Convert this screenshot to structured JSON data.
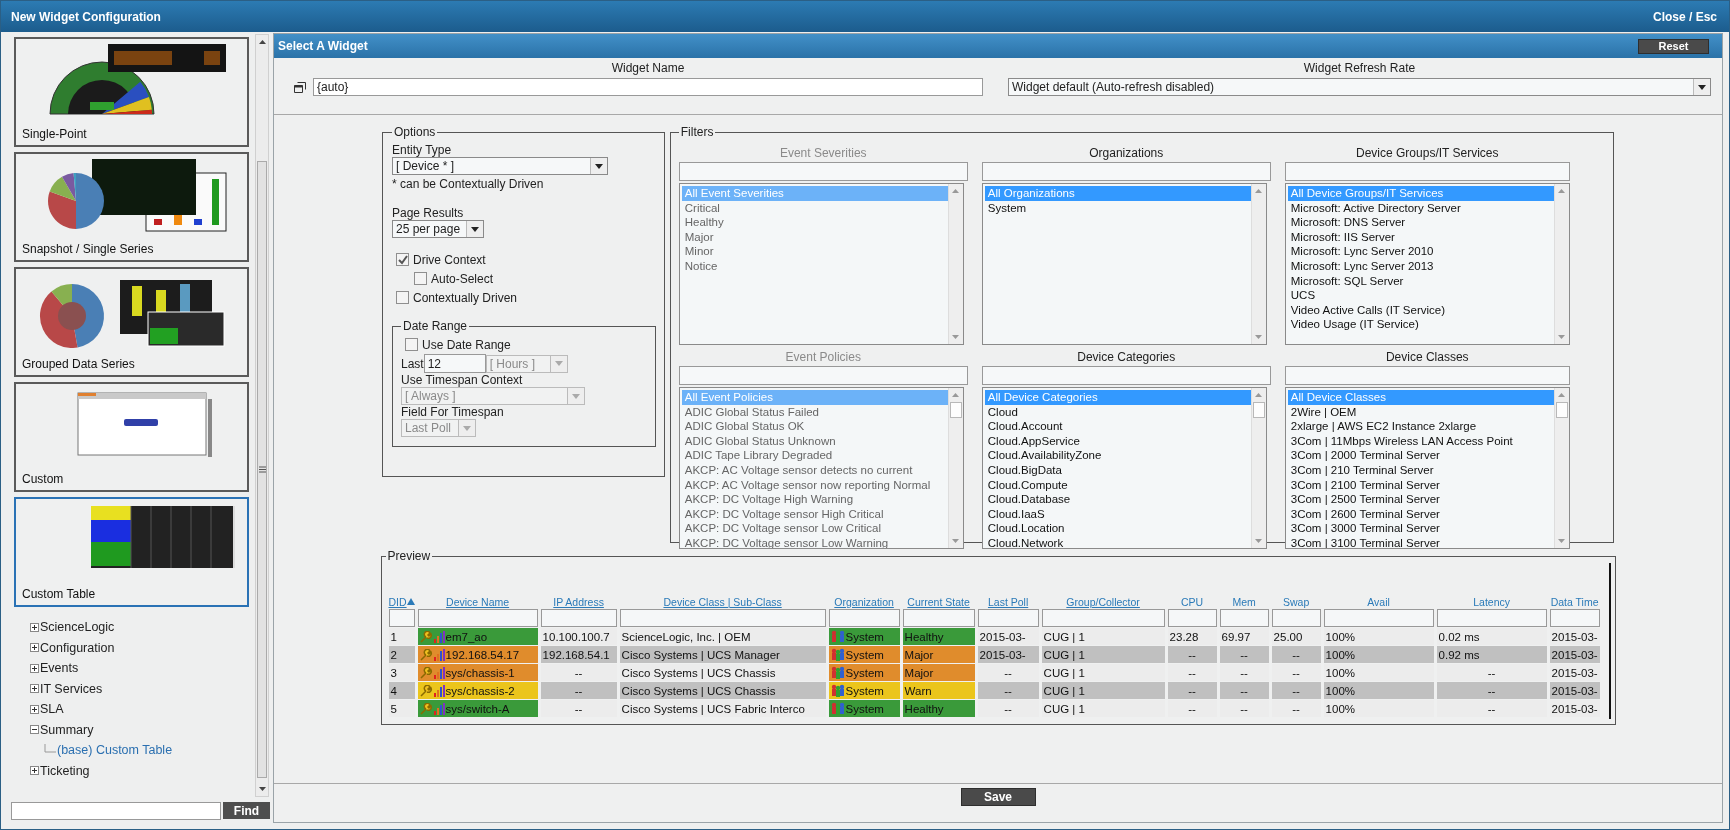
{
  "window": {
    "title": "New Widget Configuration",
    "close": "Close / Esc"
  },
  "sidebar": {
    "widgets": [
      {
        "label": "Single-Point",
        "kind": "gauge",
        "selected": false
      },
      {
        "label": "Snapshot / Single Series",
        "kind": "pie",
        "selected": false
      },
      {
        "label": "Grouped Data Series",
        "kind": "donut",
        "selected": false
      },
      {
        "label": "Custom",
        "kind": "web",
        "selected": false
      },
      {
        "label": "Custom Table",
        "kind": "table",
        "selected": true
      }
    ],
    "tree": [
      {
        "label": "ScienceLogic",
        "kind": "folder",
        "expanded": false
      },
      {
        "label": "Configuration",
        "kind": "folder",
        "expanded": false
      },
      {
        "label": "Events",
        "kind": "folder",
        "expanded": false
      },
      {
        "label": "IT Services",
        "kind": "folder",
        "expanded": false
      },
      {
        "label": "SLA",
        "kind": "folder",
        "expanded": false
      },
      {
        "label": "Summary",
        "kind": "folder",
        "expanded": true,
        "children": [
          {
            "label": "(base) Custom Table",
            "kind": "widget"
          }
        ]
      },
      {
        "label": "Ticketing",
        "kind": "folder",
        "expanded": false
      }
    ],
    "find_button": "Find"
  },
  "panel": {
    "title": "Select A Widget",
    "reset_button": "Reset",
    "widget_name": {
      "label": "Widget Name",
      "value": "{auto}"
    },
    "refresh_rate": {
      "label": "Widget Refresh Rate",
      "value": "Widget default (Auto-refresh disabled)"
    }
  },
  "options": {
    "legend": "Options",
    "entity_type": {
      "label": "Entity Type",
      "value": "[ Device * ]"
    },
    "entity_note": "* can be Contextually Driven",
    "page_results": {
      "label": "Page Results",
      "value": "25 per page"
    },
    "checkboxes": [
      {
        "label": "Drive Context",
        "checked": true,
        "children": [
          {
            "label": "Auto-Select",
            "checked": false
          }
        ]
      },
      {
        "label": "Contextually Driven",
        "checked": false
      }
    ],
    "date_range": {
      "legend": "Date Range",
      "use_date_range": {
        "label": "Use Date Range",
        "checked": false
      },
      "last_label": "Last",
      "last_value": "12",
      "unit": {
        "value": "[ Hours ]",
        "disabled": true
      },
      "timespan_context": {
        "label": "Use Timespan Context",
        "value": "[ Always ]",
        "disabled": true
      },
      "timespan_field": {
        "label": "Field For Timespan",
        "value": "Last Poll",
        "disabled": true
      }
    }
  },
  "filters": {
    "legend": "Filters",
    "lists": [
      {
        "title": "Event Severities",
        "disabled": true,
        "items": [
          {
            "label": "All Event Severities",
            "selected": true
          },
          {
            "label": "Critical",
            "selected": false
          },
          {
            "label": "Healthy",
            "selected": false
          },
          {
            "label": "Major",
            "selected": false
          },
          {
            "label": "Minor",
            "selected": false
          },
          {
            "label": "Notice",
            "selected": false
          }
        ]
      },
      {
        "title": "Organizations",
        "disabled": false,
        "items": [
          {
            "label": "All Organizations",
            "selected": true
          },
          {
            "label": "System",
            "selected": false
          }
        ]
      },
      {
        "title": "Device Groups/IT Services",
        "disabled": false,
        "items": [
          {
            "label": "All Device Groups/IT Services",
            "selected": true
          },
          {
            "label": "Microsoft: Active Directory Server",
            "selected": false
          },
          {
            "label": "Microsoft: DNS Server",
            "selected": false
          },
          {
            "label": "Microsoft: IIS Server",
            "selected": false
          },
          {
            "label": "Microsoft: Lync Server 2010",
            "selected": false
          },
          {
            "label": "Microsoft: Lync Server 2013",
            "selected": false
          },
          {
            "label": "Microsoft: SQL Server",
            "selected": false
          },
          {
            "label": "UCS",
            "selected": false
          },
          {
            "label": "Video Active Calls (IT Service)",
            "selected": false
          },
          {
            "label": "Video Usage (IT Service)",
            "selected": false
          }
        ]
      },
      {
        "title": "Event Policies",
        "disabled": true,
        "items": [
          {
            "label": "All Event Policies",
            "selected": true
          },
          {
            "label": "ADIC Global Status Failed",
            "selected": false
          },
          {
            "label": "ADIC Global Status OK",
            "selected": false
          },
          {
            "label": "ADIC Global Status Unknown",
            "selected": false
          },
          {
            "label": "ADIC Tape Library Degraded",
            "selected": false
          },
          {
            "label": "AKCP: AC Voltage sensor detects no current",
            "selected": false
          },
          {
            "label": "AKCP: AC Voltage sensor now reporting Normal",
            "selected": false
          },
          {
            "label": "AKCP: DC Voltage High Warning",
            "selected": false
          },
          {
            "label": "AKCP: DC Voltage sensor High Critical",
            "selected": false
          },
          {
            "label": "AKCP: DC Voltage sensor Low Critical",
            "selected": false
          },
          {
            "label": "AKCP: DC Voltage sensor Low Warning",
            "selected": false
          }
        ]
      },
      {
        "title": "Device Categories",
        "disabled": false,
        "items": [
          {
            "label": "All Device Categories",
            "selected": true
          },
          {
            "label": "Cloud",
            "selected": false
          },
          {
            "label": "Cloud.Account",
            "selected": false
          },
          {
            "label": "Cloud.AppService",
            "selected": false
          },
          {
            "label": "Cloud.AvailabilityZone",
            "selected": false
          },
          {
            "label": "Cloud.BigData",
            "selected": false
          },
          {
            "label": "Cloud.Compute",
            "selected": false
          },
          {
            "label": "Cloud.Database",
            "selected": false
          },
          {
            "label": "Cloud.IaaS",
            "selected": false
          },
          {
            "label": "Cloud.Location",
            "selected": false
          },
          {
            "label": "Cloud.Network",
            "selected": false
          }
        ]
      },
      {
        "title": "Device Classes",
        "disabled": false,
        "items": [
          {
            "label": "All Device Classes",
            "selected": true
          },
          {
            "label": "2Wire | OEM",
            "selected": false
          },
          {
            "label": "2xlarge | AWS EC2 Instance 2xlarge",
            "selected": false
          },
          {
            "label": "3Com | 11Mbps Wireless LAN Access Point",
            "selected": false
          },
          {
            "label": "3Com | 2000 Terminal Server",
            "selected": false
          },
          {
            "label": "3Com | 210 Terminal Server",
            "selected": false
          },
          {
            "label": "3Com | 2100 Terminal Server",
            "selected": false
          },
          {
            "label": "3Com | 2500 Terminal Server",
            "selected": false
          },
          {
            "label": "3Com | 2600 Terminal Server",
            "selected": false
          },
          {
            "label": "3Com | 3000 Terminal Server",
            "selected": false
          },
          {
            "label": "3Com | 3100 Terminal Server",
            "selected": false
          }
        ]
      }
    ]
  },
  "preview": {
    "legend": "Preview",
    "columns": [
      {
        "label": "DID",
        "link": true,
        "sorted": true
      },
      {
        "label": "Device Name",
        "link": true,
        "sorted": false
      },
      {
        "label": "IP Address",
        "link": true,
        "sorted": false
      },
      {
        "label": "Device Class | Sub-Class",
        "link": true,
        "sorted": false
      },
      {
        "label": "Organization",
        "link": true,
        "sorted": false
      },
      {
        "label": "Current State",
        "link": true,
        "sorted": false
      },
      {
        "label": "Last Poll",
        "link": true,
        "sorted": false
      },
      {
        "label": "Group/Collector",
        "link": true,
        "sorted": false
      },
      {
        "label": "CPU",
        "link": false,
        "sorted": false
      },
      {
        "label": "Mem",
        "link": false,
        "sorted": false
      },
      {
        "label": "Swap",
        "link": false,
        "sorted": false
      },
      {
        "label": "Avail",
        "link": false,
        "sorted": false
      },
      {
        "label": "Latency",
        "link": false,
        "sorted": false
      },
      {
        "label": "Data Time",
        "link": false,
        "sorted": false
      }
    ],
    "rows": [
      {
        "color": "#3a9a3a",
        "cells": [
          "1",
          "em7_ao",
          "10.100.100.7",
          "ScienceLogic, Inc. | OEM",
          "System",
          "Healthy",
          "2015-03-",
          "CUG | 1",
          "23.28",
          "69.97",
          "25.00",
          "100%",
          "0.02 ms",
          "2015-03-"
        ]
      },
      {
        "color": "#e08c2c",
        "cells": [
          "2",
          "192.168.54.17",
          "192.168.54.1",
          "Cisco Systems | UCS Manager",
          "System",
          "Major",
          "2015-03-",
          "CUG | 1",
          "--",
          "--",
          "--",
          "100%",
          "0.92 ms",
          "2015-03-"
        ]
      },
      {
        "color": "#e08c2c",
        "cells": [
          "3",
          "sys/chassis-1",
          "--",
          "Cisco Systems | UCS Chassis",
          "System",
          "Major",
          "--",
          "CUG | 1",
          "--",
          "--",
          "--",
          "100%",
          "--",
          "2015-03-"
        ]
      },
      {
        "color": "#ebc51c",
        "cells": [
          "4",
          "sys/chassis-2",
          "--",
          "Cisco Systems | UCS Chassis",
          "System",
          "Warn",
          "--",
          "CUG | 1",
          "--",
          "--",
          "--",
          "100%",
          "--",
          "2015-03-"
        ]
      },
      {
        "color": "#3a9a3a",
        "cells": [
          "5",
          "sys/switch-A",
          "--",
          "Cisco Systems | UCS Fabric Interco",
          "System",
          "Healthy",
          "--",
          "CUG | 1",
          "--",
          "--",
          "--",
          "100%",
          "--",
          "2015-03-"
        ]
      }
    ]
  },
  "footer": {
    "save_button": "Save"
  }
}
